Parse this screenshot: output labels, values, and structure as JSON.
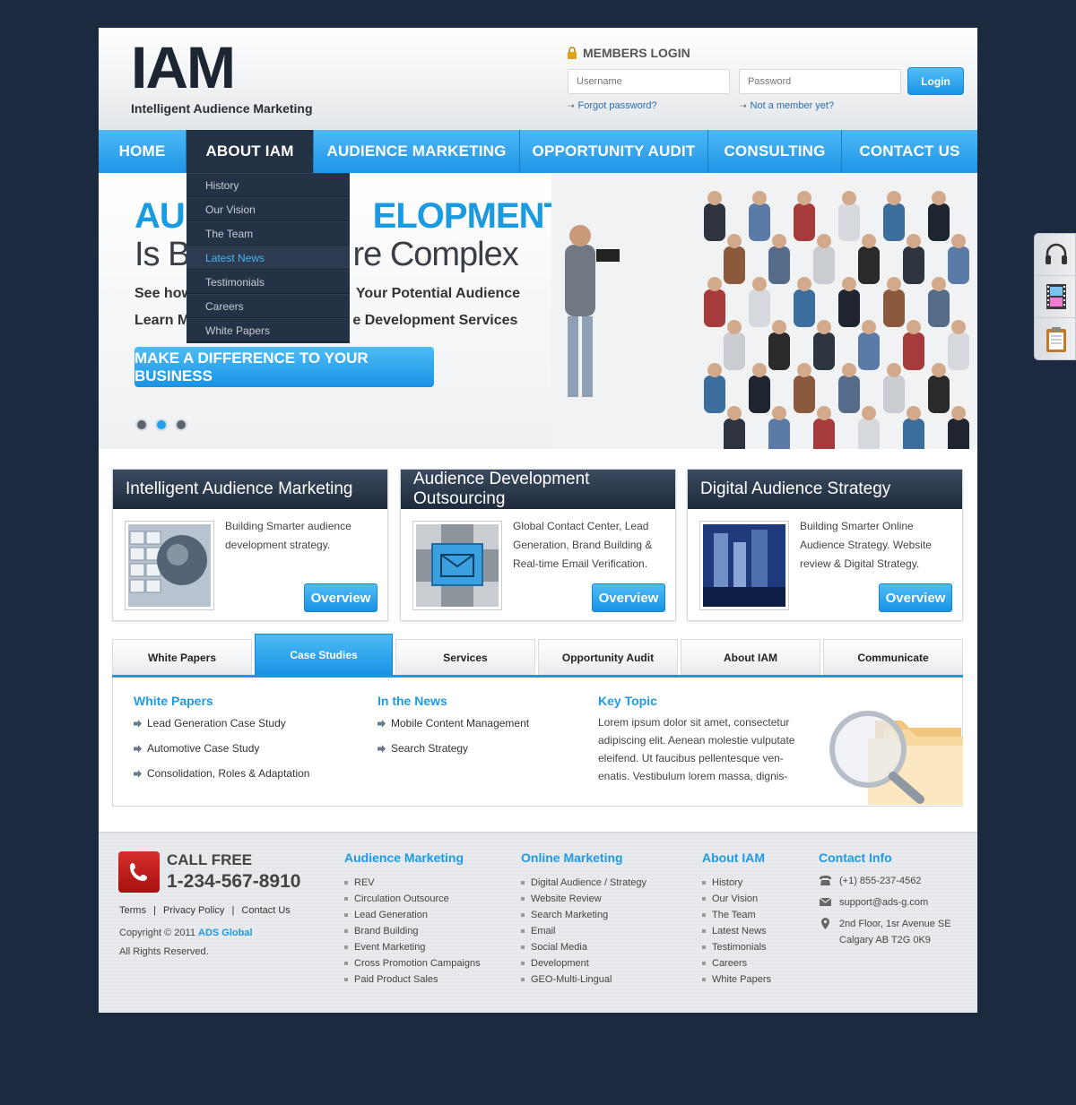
{
  "header": {
    "logo": "IAM",
    "tagline": "Intelligent Audience Marketing",
    "login_title": "MEMBERS LOGIN",
    "username_placeholder": "Username",
    "password_placeholder": "Password",
    "login_button": "Login",
    "forgot_link": "Forgot password?",
    "member_link": "Not a member yet?"
  },
  "nav": {
    "items": [
      "HOME",
      "ABOUT IAM",
      "AUDIENCE MARKETING",
      "OPPORTUNITY AUDIT",
      "CONSULTING",
      "CONTACT US"
    ]
  },
  "dropdown": {
    "items": [
      "History",
      "Our Vision",
      "The Team",
      "Latest News",
      "Testimonials",
      "Careers",
      "White Papers"
    ],
    "highlighted": "Latest News"
  },
  "hero": {
    "headline_visible_left": "AUD",
    "headline_visible_right": "ELOPMENT",
    "subhead_visible_left": "Is B",
    "subhead_visible_right": "re Complex",
    "line1_left": "See how",
    "line1_right": "Your Potential Audience",
    "line2_left": "Learn M",
    "line2_right": "e Development Services",
    "cta": "MAKE A DIFFERENCE TO YOUR BUSINESS",
    "slide_count": 3,
    "active_slide": 2
  },
  "boxes": [
    {
      "title": "Intelligent Audience Marketing",
      "text": "Building Smarter audience development strategy.",
      "button": "Overview",
      "image": "globe-keyboard-image"
    },
    {
      "title": "Audience Development Outsourcing",
      "text": "Global Contact Center, Lead Generation, Brand Building & Real-time Email Verification.",
      "button": "Overview",
      "image": "email-key-image"
    },
    {
      "title": "Digital Audience Strategy",
      "text": "Building Smarter Online Audience Strategy. Website review & Digital Strategy.",
      "button": "Overview",
      "image": "city-business-image"
    }
  ],
  "tabs": {
    "items": [
      "White Papers",
      "Case Studies",
      "Services",
      "Opportunity Audit",
      "About IAM",
      "Communicate"
    ],
    "active": "Case Studies"
  },
  "tab_panel": {
    "col1": {
      "title": "White Papers",
      "items": [
        "Lead Generation Case Study",
        "Automotive Case Study",
        "Consolidation, Roles & Adaptation"
      ]
    },
    "col2": {
      "title": "In the News",
      "items": [
        "Mobile Content Management",
        "Search Strategy"
      ]
    },
    "col3": {
      "title": "Key Topic",
      "text": "Lorem ipsum dolor sit amet, consectetur adipiscing elit. Aenean molestie vulputate eleifend. Ut faucibus pellentesque ven-enatis. Vestibulum lorem massa, dignis-"
    }
  },
  "footer": {
    "call_label": "CALL FREE",
    "phone": "1-234-567-8910",
    "links": [
      "Terms",
      "Privacy Policy",
      "Contact Us"
    ],
    "copyright_prefix": "Copyright © 2011",
    "company": "ADS Global",
    "rights": "All Rights Reserved.",
    "col_audience": {
      "title": "Audience Marketing",
      "items": [
        "REV",
        "Circulation Outsource",
        "Lead Generation",
        "Brand Building",
        "Event Marketing",
        "Cross Promotion Campaigns",
        "Paid Product Sales"
      ]
    },
    "col_online": {
      "title": "Online Marketing",
      "items": [
        "Digital Audience / Strategy",
        "Website Review",
        "Search Marketing",
        "Email",
        "Social Media",
        "Development",
        "GEO-Multi-Lingual"
      ]
    },
    "col_about": {
      "title": "About IAM",
      "items": [
        "History",
        "Our Vision",
        "The Team",
        "Latest News",
        "Testimonials",
        "Careers",
        "White Papers"
      ]
    },
    "contact": {
      "title": "Contact Info",
      "phone": "(+1) 855-237-4562",
      "email": "support@ads-g.com",
      "address1": "2nd Floor, 1sr Avenue SE",
      "address2": "Calgary AB T2G 0K9"
    }
  },
  "colors": {
    "accent_blue": "#1f9ae3",
    "dark_navy": "#243246",
    "background": "#1c2a3f"
  }
}
